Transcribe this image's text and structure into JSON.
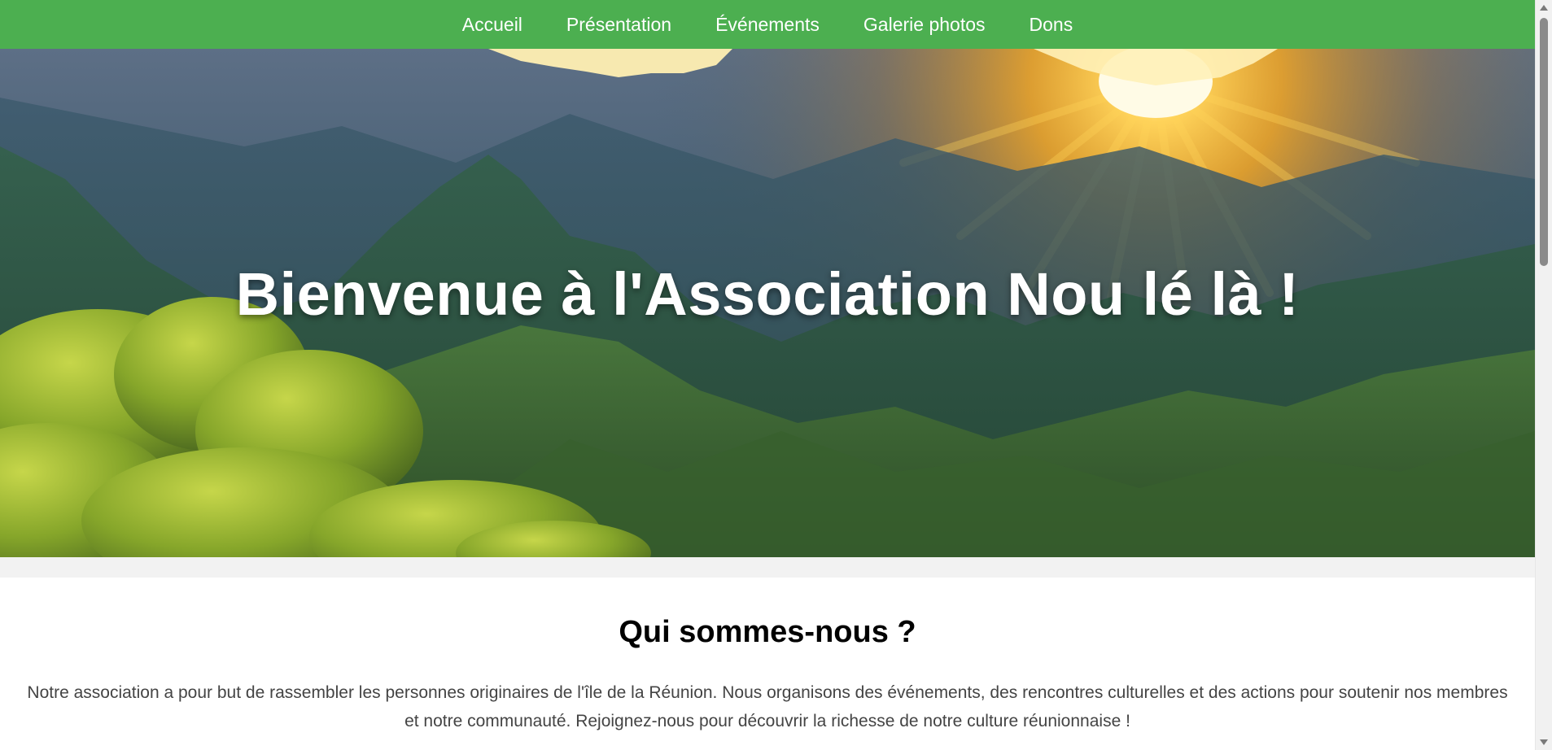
{
  "nav": {
    "items": [
      {
        "label": "Accueil"
      },
      {
        "label": "Présentation"
      },
      {
        "label": "Événements"
      },
      {
        "label": "Galerie photos"
      },
      {
        "label": "Dons"
      }
    ]
  },
  "hero": {
    "title": "Bienvenue à l'Association Nou lé là !",
    "image": "mountain-sunset-landscape"
  },
  "about": {
    "title": "Qui sommes-nous ?",
    "text": "Notre association a pour but de rassembler les personnes originaires de l'île de la Réunion. Nous organisons des événements, des rencontres culturelles et des actions pour soutenir nos membres et notre communauté. Rejoignez-nous pour découvrir la richesse de notre culture réunionnaise !"
  },
  "colors": {
    "nav_bg": "#4caf50",
    "nav_text": "#ffffff",
    "hero_title": "#ffffff",
    "about_text": "#444444"
  }
}
